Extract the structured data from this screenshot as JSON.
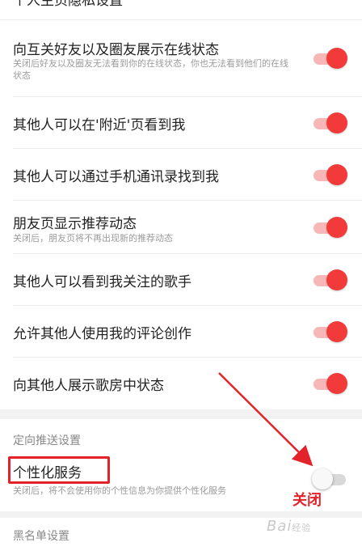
{
  "header_cut": {
    "title": "个人主页隐私设置"
  },
  "settings": [
    {
      "title": "向互关好友以及圈友展示在线状态",
      "subtitle": "关闭后好友以及圈友无法看到你的在线状态，你也无法看到他们的在线状态",
      "enabled": true
    },
    {
      "title": "其他人可以在'附近'页看到我",
      "subtitle": "",
      "enabled": true
    },
    {
      "title": "其他人可以通过手机通讯录找到我",
      "subtitle": "",
      "enabled": true
    },
    {
      "title": "朋友页显示推荐动态",
      "subtitle": "关闭后，朋友页将不再出现新的推荐动态",
      "enabled": true
    },
    {
      "title": "其他人可以看到我关注的歌手",
      "subtitle": "",
      "enabled": true
    },
    {
      "title": "允许其他人使用我的评论创作",
      "subtitle": "",
      "enabled": true
    },
    {
      "title": "向其他人展示歌房中状态",
      "subtitle": "",
      "enabled": true
    }
  ],
  "targeted_push": {
    "section_label": "定向推送设置",
    "item": {
      "title": "个性化服务",
      "subtitle": "关闭后，将不会使用你的个性信息为你提供个性化服务",
      "enabled": false
    }
  },
  "blacklist": {
    "section_label": "黑名单设置"
  },
  "annotation": {
    "label": "关闭",
    "color": "#e3232a"
  },
  "watermark": {
    "text": "Bai",
    "suffix": "经验"
  },
  "colors": {
    "toggle_on": "#f23a3a",
    "toggle_on_track": "#f7b7b7",
    "toggle_off_track": "#d9d9d9"
  }
}
